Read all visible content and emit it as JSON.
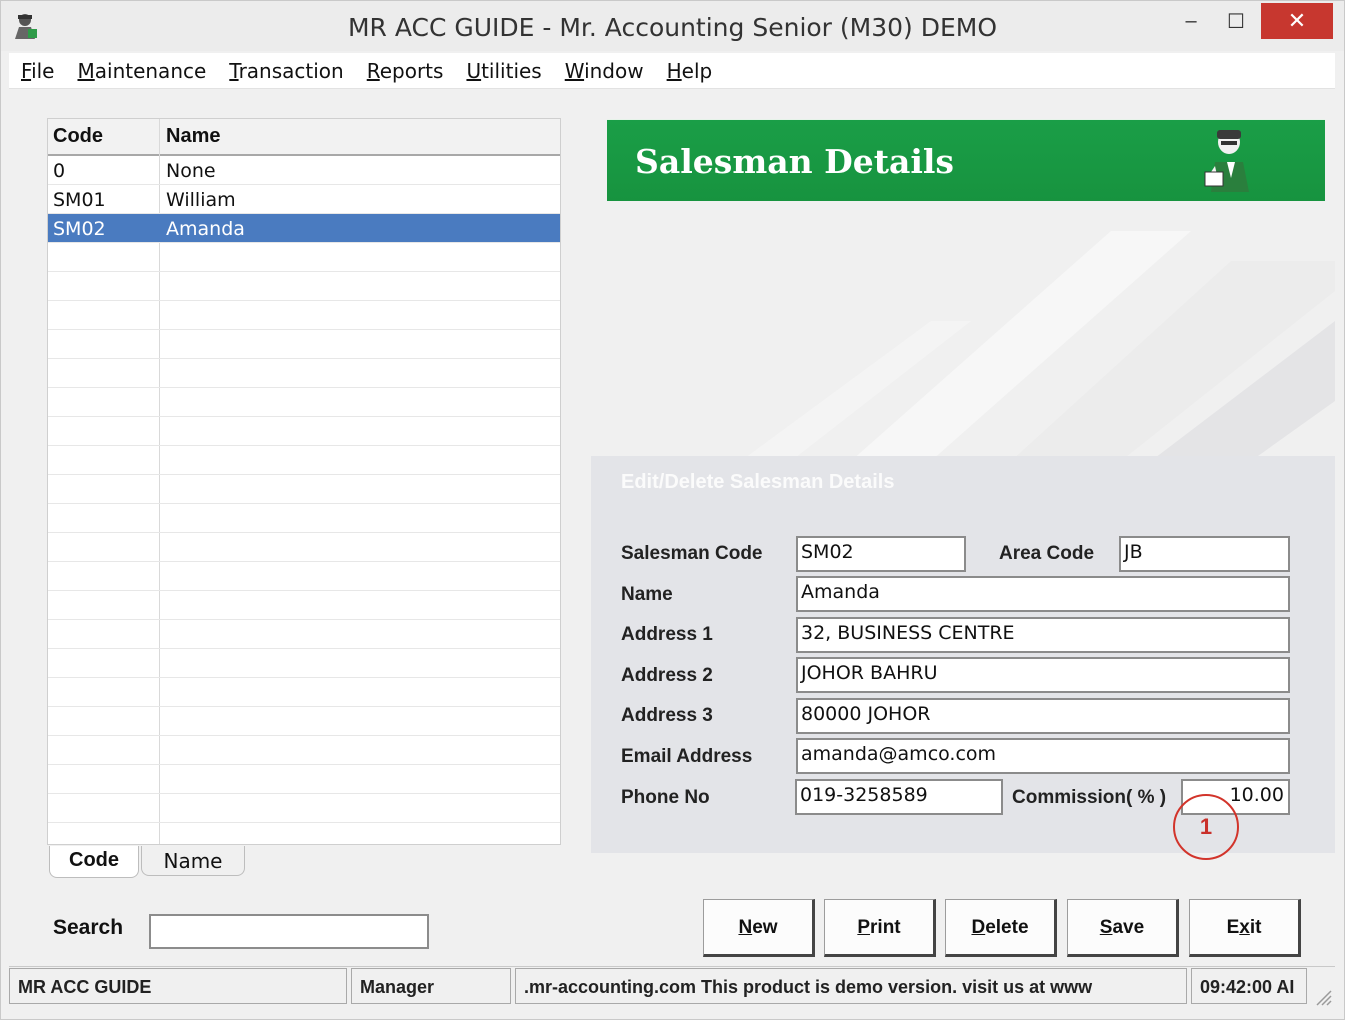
{
  "window": {
    "title": "MR ACC GUIDE - Mr. Accounting Senior (M30) DEMO",
    "minimize_glyph": "–",
    "maximize_glyph": "☐",
    "close_glyph": "✕"
  },
  "menu": {
    "file": {
      "accel": "F",
      "rest": "ile"
    },
    "maintenance": {
      "accel": "M",
      "rest": "aintenance"
    },
    "transaction": {
      "accel": "T",
      "rest": "ransaction"
    },
    "reports": {
      "accel": "R",
      "rest": "eports"
    },
    "utilities": {
      "accel": "U",
      "rest": "tilities"
    },
    "window": {
      "accel": "W",
      "rest": "indow"
    },
    "help": {
      "accel": "H",
      "rest": "elp"
    }
  },
  "grid": {
    "headers": {
      "code": "Code",
      "name": "Name"
    },
    "rows": [
      {
        "code": "0",
        "name": "None",
        "selected": false
      },
      {
        "code": "SM01",
        "name": "William",
        "selected": false
      },
      {
        "code": "SM02",
        "name": "Amanda",
        "selected": true
      }
    ]
  },
  "tabs": {
    "code": "Code",
    "name": "Name"
  },
  "search": {
    "label": "Search",
    "value": ""
  },
  "banner": {
    "title": "Salesman Details",
    "icon": "accountant-figure-icon"
  },
  "form": {
    "panel_title": "Edit/Delete Salesman Details",
    "labels": {
      "salesman_code": "Salesman Code",
      "area_code": "Area Code",
      "name": "Name",
      "address1": "Address 1",
      "address2": "Address 2",
      "address3": "Address 3",
      "email": "Email Address",
      "phone": "Phone No",
      "commission": "Commission( % )"
    },
    "values": {
      "salesman_code": "SM02",
      "area_code": "JB",
      "name": "Amanda",
      "address1": "32, BUSINESS CENTRE",
      "address2": "JOHOR BAHRU",
      "address3": "80000 JOHOR",
      "email": "amanda@amco.com",
      "phone": "019-3258589",
      "commission": "10.00"
    }
  },
  "annotation": {
    "marker": "1"
  },
  "buttons": {
    "new": {
      "accel": "N",
      "rest": "ew"
    },
    "print": {
      "accel": "P",
      "rest": "rint"
    },
    "delete": {
      "accel": "D",
      "rest": "elete"
    },
    "save": {
      "accel": "S",
      "rest": "ave"
    },
    "exit": {
      "pre": "E",
      "accel": "x",
      "rest": "it"
    }
  },
  "statusbar": {
    "company": "MR ACC GUIDE",
    "user": "Manager",
    "message": ".mr-accounting.com This product is demo version.  visit us at www",
    "time": "09:42:00 AI"
  },
  "colors": {
    "banner_green": "#1a9e47",
    "selection_blue": "#4a7bc0",
    "close_red": "#c7372f",
    "marker_red": "#d2342b"
  }
}
